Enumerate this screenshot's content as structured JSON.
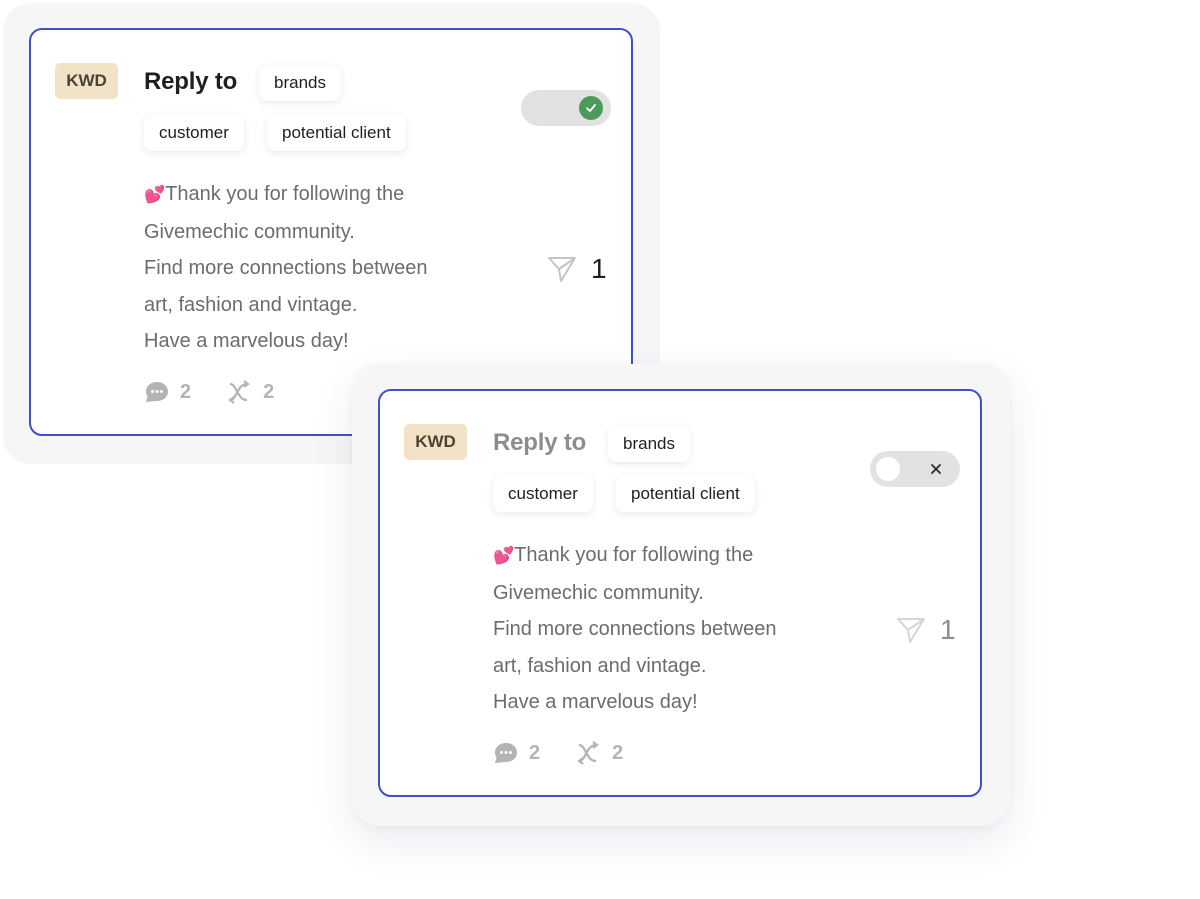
{
  "cards": [
    {
      "state": "enabled",
      "badge": "KWD",
      "title": "Reply to",
      "tags": [
        "brands",
        "customer",
        "potential client"
      ],
      "toggle": {
        "on": true,
        "icon": "check-icon"
      },
      "message": {
        "emoji": "💕",
        "lines": [
          "Thank you for following the",
          "Givemechic community.",
          "Find more connections between",
          "art, fashion and vintage.",
          "Have a marvelous day!"
        ]
      },
      "send_icon": "send-icon",
      "send_count": "1",
      "stats": {
        "comments": "2",
        "shuffle": "2"
      }
    },
    {
      "state": "disabled",
      "badge": "KWD",
      "title": "Reply to",
      "tags": [
        "brands",
        "customer",
        "potential client"
      ],
      "toggle": {
        "on": false,
        "icon": "close-icon"
      },
      "message": {
        "emoji": "💕",
        "lines": [
          "Thank you for following the",
          "Givemechic community.",
          "Find more connections between",
          "art, fashion and vintage.",
          "Have a marvelous day!"
        ]
      },
      "send_icon": "send-icon",
      "send_count": "1",
      "stats": {
        "comments": "2",
        "shuffle": "2"
      }
    }
  ],
  "colors": {
    "card_border": "#3f51c9",
    "badge_bg": "#f2e3c6",
    "toggle_on": "#4a9a5c",
    "toggle_track": "#e2e2e3"
  }
}
